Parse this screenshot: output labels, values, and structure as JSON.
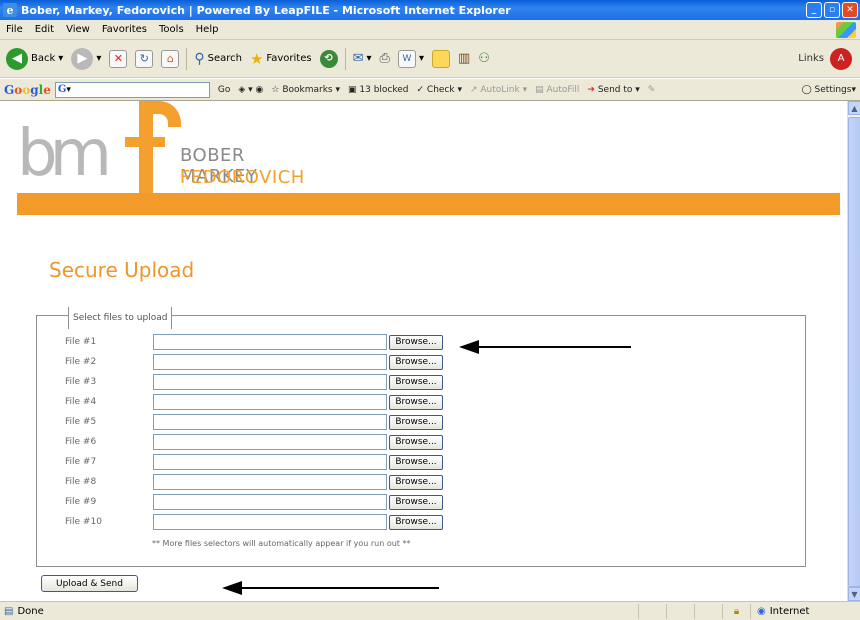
{
  "window": {
    "title": "Bober, Markey, Fedorovich | Powered By LeapFILE - Microsoft Internet Explorer"
  },
  "menubar": [
    "File",
    "Edit",
    "View",
    "Favorites",
    "Tools",
    "Help"
  ],
  "toolbar": {
    "back": "Back",
    "search": "Search",
    "favorites": "Favorites",
    "links": "Links"
  },
  "googlebar": {
    "logo": "Google",
    "go": "Go",
    "bookmarks": "Bookmarks",
    "blocked": "13 blocked",
    "check": "Check",
    "autolink": "AutoLink",
    "autofill": "AutoFill",
    "sendto": "Send to",
    "settings": "Settings"
  },
  "brand": {
    "monogram": "bm",
    "line1": "BOBER MARKEY",
    "line2": "FEDOROVICH",
    "accent": "#f39b2a"
  },
  "page": {
    "heading": "Secure Upload",
    "legend": "Select files to upload",
    "browse_label": "Browse...",
    "files": [
      "File #1",
      "File #2",
      "File #3",
      "File #4",
      "File #5",
      "File #6",
      "File #7",
      "File #8",
      "File #9",
      "File #10"
    ],
    "note": "** More files selectors will automatically appear if you run out **",
    "upload_button": "Upload & Send"
  },
  "status": {
    "left": "Done",
    "zone": "Internet"
  }
}
